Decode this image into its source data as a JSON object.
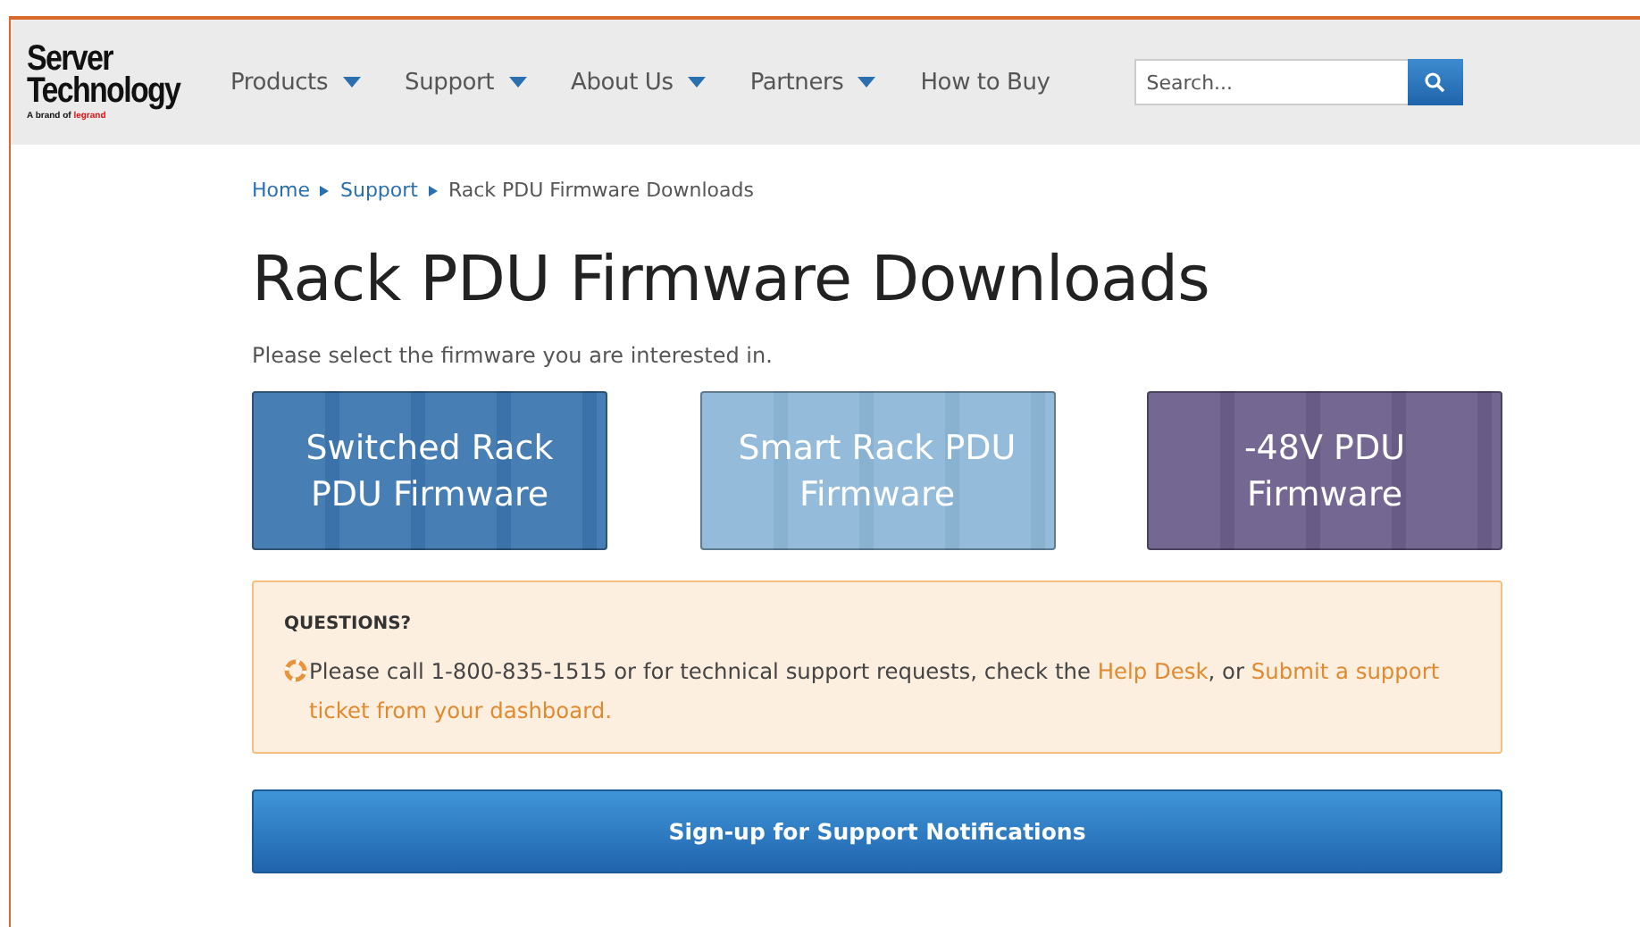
{
  "logo": {
    "name_line1": "Server",
    "name_line2": "Technology",
    "tagline": "A brand of",
    "brand": "legrand"
  },
  "nav": [
    {
      "label": "Products",
      "dropdown": true
    },
    {
      "label": "Support",
      "dropdown": true
    },
    {
      "label": "About Us",
      "dropdown": true
    },
    {
      "label": "Partners",
      "dropdown": true
    },
    {
      "label": "How to Buy",
      "dropdown": false
    }
  ],
  "search": {
    "placeholder": "Search..."
  },
  "breadcrumb": [
    {
      "label": "Home",
      "kind": "link"
    },
    {
      "label": "Support",
      "kind": "link"
    },
    {
      "label": "Rack PDU Firmware Downloads",
      "kind": "current"
    }
  ],
  "title": "Rack PDU Firmware Downloads",
  "intro": "Please select the firmware you are interested in.",
  "cards": [
    {
      "label": "Switched Rack PDU Firmware",
      "color": "#3c76ae"
    },
    {
      "label": "Smart Rack PDU Firmware",
      "color": "#8db8d8"
    },
    {
      "label": "-48V PDU Firmware",
      "color": "#6b5e8a"
    }
  ],
  "questions": {
    "heading": "QUESTIONS?",
    "message": [
      {
        "kind": "text",
        "text": "Please call 1-800-835-1515 or for technical support requests, check the "
      },
      {
        "kind": "link",
        "text": "Help Desk"
      },
      {
        "kind": "text",
        "text": ", or "
      },
      {
        "kind": "link",
        "text": "Submit a support"
      },
      {
        "kind": "link",
        "text": "ticket from your dashboard."
      }
    ]
  },
  "signup_button": "Sign-up for Support Notifications"
}
